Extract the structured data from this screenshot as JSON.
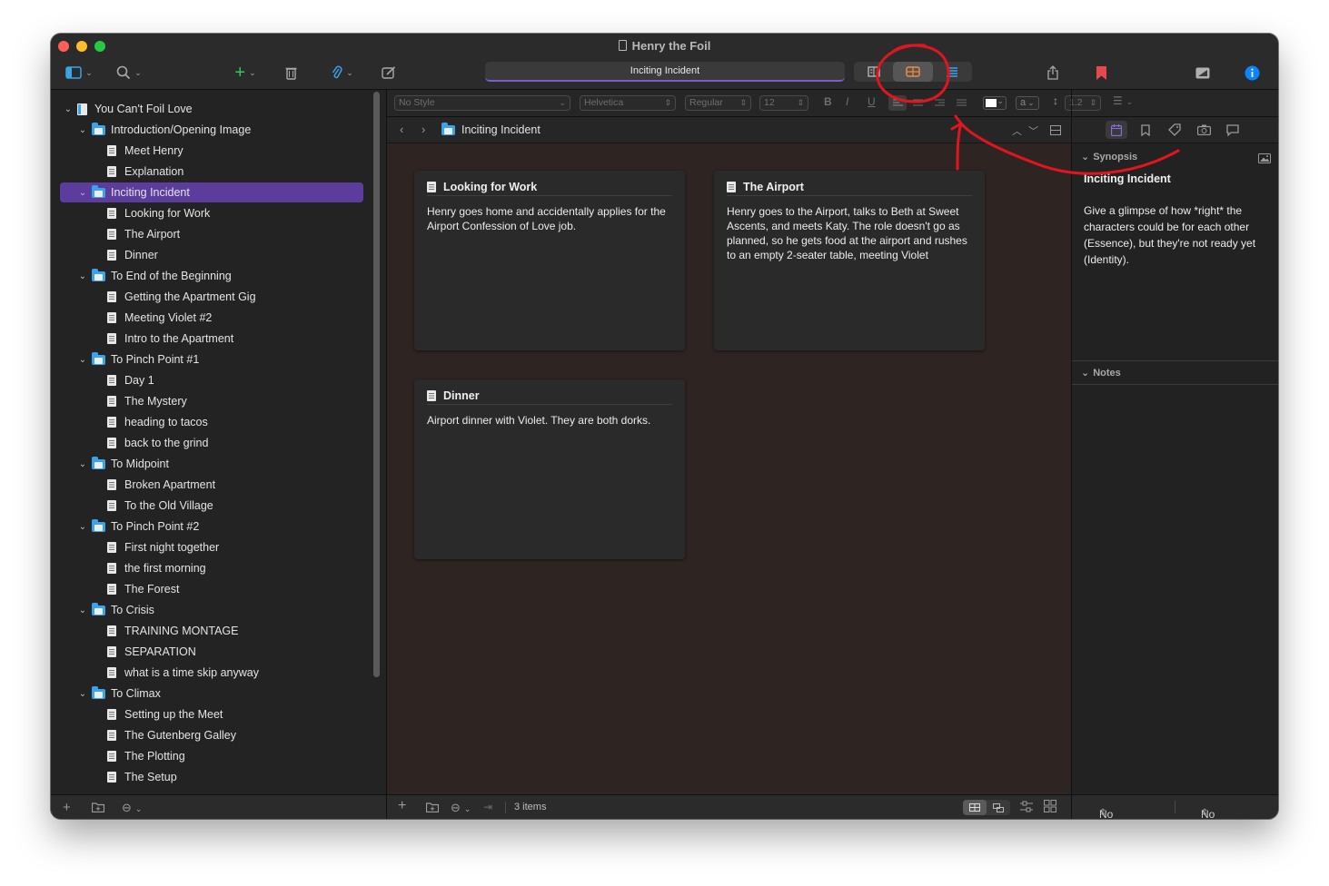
{
  "window": {
    "title": "Henry the Foil"
  },
  "toolbar": {
    "path": "Inciting Incident",
    "view_modes": [
      "Scrivenings",
      "Corkboard",
      "Outline"
    ],
    "active_view": "Corkboard"
  },
  "binder": {
    "items": [
      {
        "label": "You Can't Foil Love",
        "type": "root",
        "level": 0
      },
      {
        "label": "Introduction/Opening Image",
        "type": "folder",
        "level": 1
      },
      {
        "label": "Meet Henry",
        "type": "doc",
        "level": 2
      },
      {
        "label": "Explanation",
        "type": "doc",
        "level": 2
      },
      {
        "label": "Inciting Incident",
        "type": "folder",
        "level": 1,
        "selected": true
      },
      {
        "label": "Looking for Work",
        "type": "doc",
        "level": 2
      },
      {
        "label": "The Airport",
        "type": "doc",
        "level": 2
      },
      {
        "label": "Dinner",
        "type": "doc",
        "level": 2
      },
      {
        "label": "To End of the Beginning",
        "type": "folder",
        "level": 1
      },
      {
        "label": "Getting the Apartment Gig",
        "type": "doc",
        "level": 2
      },
      {
        "label": "Meeting Violet #2",
        "type": "doc",
        "level": 2
      },
      {
        "label": "Intro to the Apartment",
        "type": "doc",
        "level": 2
      },
      {
        "label": "To Pinch Point #1",
        "type": "folder",
        "level": 1
      },
      {
        "label": "Day 1",
        "type": "doc",
        "level": 2
      },
      {
        "label": "The Mystery",
        "type": "doc",
        "level": 2
      },
      {
        "label": "heading to tacos",
        "type": "doc",
        "level": 2
      },
      {
        "label": "back to the grind",
        "type": "doc",
        "level": 2
      },
      {
        "label": "To Midpoint",
        "type": "folder",
        "level": 1
      },
      {
        "label": "Broken Apartment",
        "type": "doc",
        "level": 2
      },
      {
        "label": "To the Old Village",
        "type": "doc",
        "level": 2
      },
      {
        "label": "To Pinch Point #2",
        "type": "folder",
        "level": 1
      },
      {
        "label": "First night together",
        "type": "doc",
        "level": 2
      },
      {
        "label": "the first morning",
        "type": "doc",
        "level": 2
      },
      {
        "label": "The Forest",
        "type": "doc",
        "level": 2
      },
      {
        "label": "To Crisis",
        "type": "folder",
        "level": 1
      },
      {
        "label": "TRAINING MONTAGE",
        "type": "doc",
        "level": 2
      },
      {
        "label": "SEPARATION",
        "type": "doc",
        "level": 2
      },
      {
        "label": "what is a time skip anyway",
        "type": "doc",
        "level": 2
      },
      {
        "label": "To Climax",
        "type": "folder",
        "level": 1
      },
      {
        "label": "Setting up the Meet",
        "type": "doc",
        "level": 2
      },
      {
        "label": "The Gutenberg Galley",
        "type": "doc",
        "level": 2
      },
      {
        "label": "The Plotting",
        "type": "doc",
        "level": 2
      },
      {
        "label": "The Setup",
        "type": "doc",
        "level": 2
      }
    ]
  },
  "formatbar": {
    "style": "No Style",
    "font": "Helvetica",
    "weight": "Regular",
    "size": "12",
    "bold": "B",
    "italic": "I",
    "underline": "U",
    "highlight": "a",
    "line_spacing": "1.2"
  },
  "editor": {
    "header_title": "Inciting Incident",
    "cards": [
      {
        "title": "Looking for Work",
        "synopsis": "Henry goes home and accidentally applies for the Airport Confession of Love job."
      },
      {
        "title": "The Airport",
        "synopsis": "Henry goes to the Airport, talks to Beth at Sweet Ascents, and meets Katy. The role doesn't go as planned, so he gets food at the airport and rushes to an empty 2-seater table, meeting Violet"
      },
      {
        "title": "Dinner",
        "synopsis": "Airport dinner with Violet. They are both dorks."
      }
    ],
    "item_count": "3 items"
  },
  "inspector": {
    "synopsis_header": "Synopsis",
    "title": "Inciting Incident",
    "synopsis": "Give a glimpse of how *right* the characters could be for each other (Essence), but they're not ready yet (Identity).",
    "notes_header": "Notes",
    "label": "No Label",
    "status": "No Status"
  },
  "colors": {
    "accent": "#7b5ccb",
    "selection": "#5c3d9e",
    "folder": "#3aa3ea",
    "corkboard": "#2e2422",
    "annotation": "#e0161e"
  }
}
